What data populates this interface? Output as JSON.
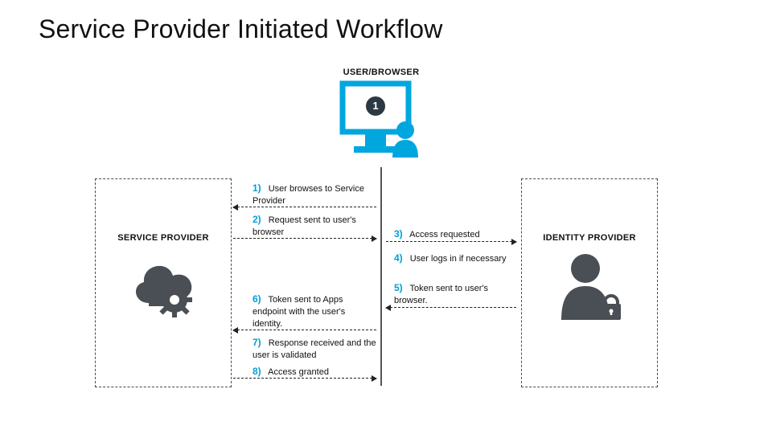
{
  "title": "Service Provider Initiated Workflow",
  "actors": {
    "user_browser": "USER/BROWSER",
    "service_provider": "SERVICE PROVIDER",
    "identity_provider": "IDENTITY PROVIDER"
  },
  "monitor_badge": "1",
  "steps": {
    "s1": {
      "num": "1)",
      "text": "User browses to Service Provider"
    },
    "s2": {
      "num": "2)",
      "text": "Request sent to user's browser"
    },
    "s3": {
      "num": "3)",
      "text": "Access requested"
    },
    "s4": {
      "num": "4)",
      "text": "User logs in if necessary"
    },
    "s5": {
      "num": "5)",
      "text": "Token sent to user's browser."
    },
    "s6": {
      "num": "6)",
      "text": "Token sent to Apps endpoint with the user's identity."
    },
    "s7": {
      "num": "7)",
      "text": "Response received and the user is validated"
    },
    "s8": {
      "num": "8)",
      "text": "Access granted"
    },
    "s8b": {
      "num": "",
      "text": ""
    }
  },
  "colors": {
    "accent": "#00A6DE",
    "icon_dark": "#4A4F55"
  }
}
